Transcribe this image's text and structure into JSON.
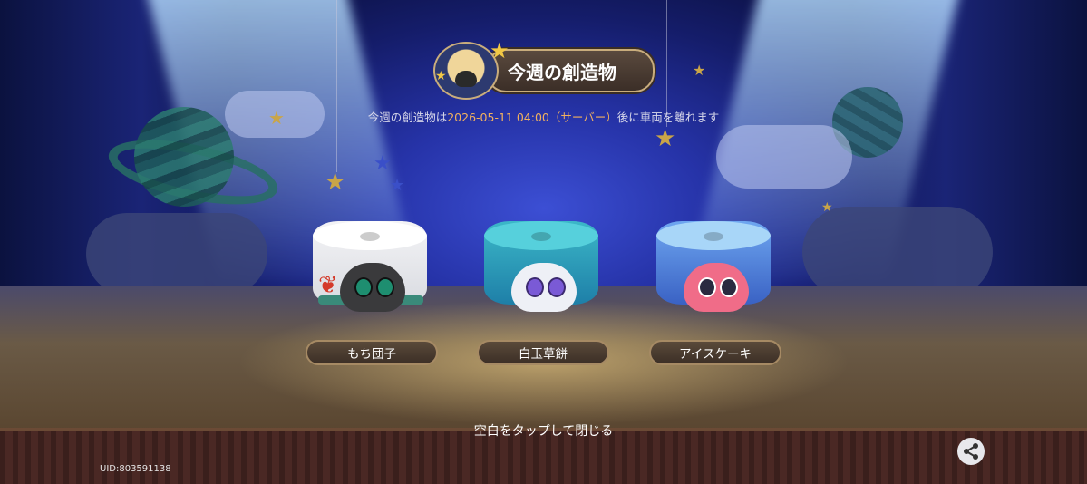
{
  "header": {
    "title": "今週の創造物"
  },
  "info": {
    "prefix": "今週の創造物は",
    "datetime": "2026-05-11 04:00（サーバー）",
    "suffix": "後に車両を離れます"
  },
  "creatures": [
    {
      "label": "もち団子"
    },
    {
      "label": "白玉草餅"
    },
    {
      "label": "アイスケーキ"
    }
  ],
  "footer": {
    "close_hint": "空白をタップして閉じる",
    "uid": "UID:803591138"
  },
  "icons": {
    "share": "share-icon",
    "star": "star-icon"
  },
  "colors": {
    "accent": "#f0b060",
    "button_border": "#a68a64"
  }
}
